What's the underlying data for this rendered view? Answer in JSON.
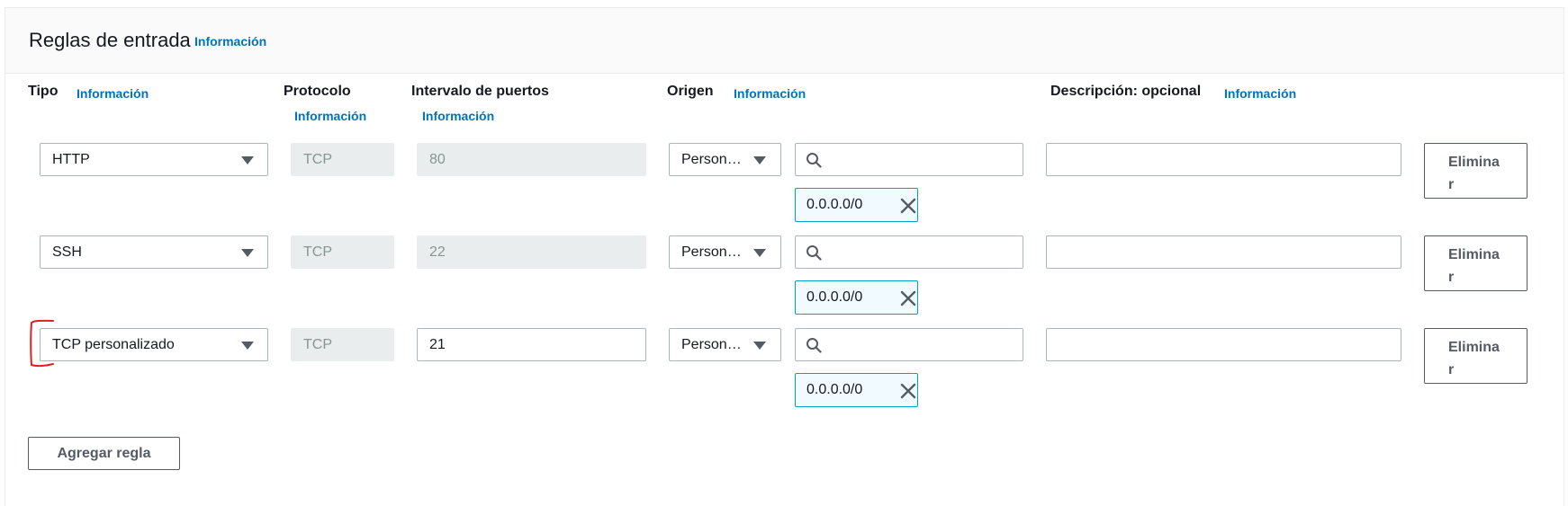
{
  "section": {
    "title": "Reglas de entrada",
    "info": "Información"
  },
  "columns": {
    "type": {
      "label": "Tipo",
      "info": "Información"
    },
    "protocol": {
      "label": "Protocolo",
      "info": "Información"
    },
    "port_range": {
      "label": "Intervalo de puertos",
      "info": "Información"
    },
    "source": {
      "label": "Origen",
      "info": "Información"
    },
    "description": {
      "label": "Descripción: opcional",
      "info": "Información"
    }
  },
  "rules": [
    {
      "type": "HTTP",
      "protocol": "TCP",
      "port": "80",
      "port_editable": false,
      "source_type": "Person…",
      "search_value": "",
      "cidr": "0.0.0.0/0",
      "description": "",
      "delete_label": "Eliminar"
    },
    {
      "type": "SSH",
      "protocol": "TCP",
      "port": "22",
      "port_editable": false,
      "source_type": "Person…",
      "search_value": "",
      "cidr": "0.0.0.0/0",
      "description": "",
      "delete_label": "Eliminar"
    },
    {
      "type": "TCP personalizado",
      "protocol": "TCP",
      "port": "21",
      "port_editable": true,
      "source_type": "Person…",
      "search_value": "",
      "cidr": "0.0.0.0/0",
      "description": "",
      "delete_label": "Eliminar"
    }
  ],
  "add_rule_label": "Agregar regla",
  "colors": {
    "link": "#0073bb",
    "token_border": "#00a1c9",
    "token_bg": "#f1faff",
    "disabled_bg": "#eaeded",
    "annotation": "#e02020"
  }
}
